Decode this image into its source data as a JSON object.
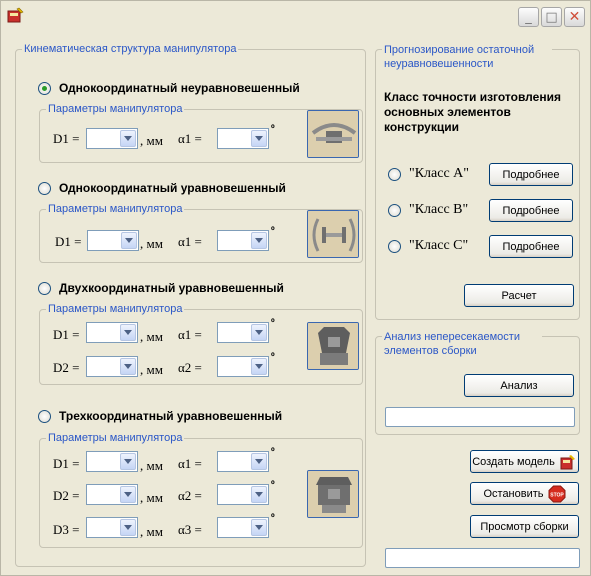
{
  "window": {
    "title": "",
    "minimize_glyph": "_",
    "maximize_glyph": "□",
    "close_glyph": "✕",
    "close_color": "#d04f3a"
  },
  "kinematic": {
    "group_title": "Кинематическая структура манипулятора",
    "params_title": "Параметры манипулятора",
    "sections": [
      {
        "label": "Однокоординатный неуравновешенный",
        "checked": true,
        "rows": [
          {
            "d": "D1 =",
            "unit": ", мм",
            "a": "α1 ="
          }
        ]
      },
      {
        "label": "Однокоординатный уравновешенный",
        "checked": false,
        "rows": [
          {
            "d": "D1 =",
            "unit": ", мм",
            "a": "α1 ="
          }
        ]
      },
      {
        "label": "Двухкоординатный уравновешенный",
        "checked": false,
        "rows": [
          {
            "d": "D1 =",
            "unit": ", мм",
            "a": "α1 ="
          },
          {
            "d": "D2 =",
            "unit": ", мм",
            "a": "α2 ="
          }
        ]
      },
      {
        "label": "Трехкоординатный уравновешенный",
        "checked": false,
        "rows": [
          {
            "d": "D1 =",
            "unit": ", мм",
            "a": "α1 ="
          },
          {
            "d": "D2 =",
            "unit": ", мм",
            "a": "α2 ="
          },
          {
            "d": "D3 =",
            "unit": ", мм",
            "a": "α3 ="
          }
        ]
      }
    ],
    "degree": "º"
  },
  "forecast": {
    "group_title": "Прогнозирование остаточной неуравновешенности",
    "heading": "Класс точности изготовления основных элементов конструкции",
    "classes": [
      {
        "label": "\"Класс А\"",
        "button": "Подробнее"
      },
      {
        "label": "\"Класс В\"",
        "button": "Подробнее"
      },
      {
        "label": "\"Класс С\"",
        "button": "Подробнее"
      }
    ],
    "calc_button": "Расчет"
  },
  "analysis": {
    "group_title": "Анализ непересекаемости элементов сборки",
    "button": "Анализ",
    "output": ""
  },
  "actions": {
    "create_model": "Создать модель",
    "stop": "Остановить",
    "stop_sign": "STOP",
    "view_assembly": "Просмотр сборки",
    "status": ""
  },
  "colors": {
    "window_bg": "#ece9d8",
    "group_title": "#2b57c7",
    "radio_checked": "#2a9b2a",
    "stop_red": "#d52b1e"
  }
}
